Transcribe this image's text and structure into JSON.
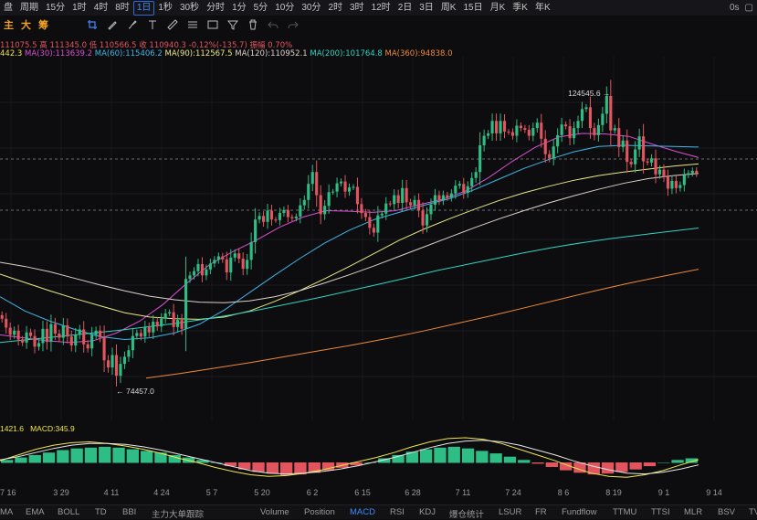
{
  "toolbar": {
    "items": [
      "盘",
      "周期",
      "15分",
      "1时",
      "4时",
      "8时",
      "1日",
      "1秒",
      "30秒",
      "分时",
      "1分",
      "5分",
      "10分",
      "30分",
      "2时",
      "3时",
      "12时",
      "2日",
      "3日",
      "周K",
      "15日",
      "月K",
      "季K",
      "年K"
    ],
    "active_index": 6,
    "right_label": "0s"
  },
  "modes": {
    "m1": "主",
    "m2": "大",
    "m3": "筹"
  },
  "info": {
    "ohlc": [
      {
        "text": "111075.5",
        "color": "#e2555f"
      },
      {
        "text": "高 111345.0",
        "color": "#e2555f"
      },
      {
        "text": "低 110566.5",
        "color": "#e2555f"
      },
      {
        "text": "收 110940.3",
        "color": "#e2555f"
      },
      {
        "text": "-0.12%(-135.7)",
        "color": "#e2555f"
      },
      {
        "text": "振幅 0.70%",
        "color": "#e2555f"
      }
    ],
    "ma": [
      {
        "text": "442.3",
        "color": "#f0e64c"
      },
      {
        "text": "MA(30):113639.2",
        "color": "#d94fd2"
      },
      {
        "text": "MA(60):115406.2",
        "color": "#3eb6e8"
      },
      {
        "text": "MA(90):112567.5",
        "color": "#e8e887"
      },
      {
        "text": "MA(120):110952.1",
        "color": "#dcd2c8"
      },
      {
        "text": "MA(200):101764.8",
        "color": "#2fd4c2"
      },
      {
        "text": "MA(360):94838.0",
        "color": "#ef8a37"
      }
    ]
  },
  "macd_info": {
    "v1": "1421.6",
    "v2": "MACD:345.9",
    "c1": "#f0e64c",
    "c2": "#f0e64c"
  },
  "x_axis": [
    "7 16",
    "3 29",
    "4 11",
    "4 24",
    "5 7",
    "5 20",
    "6 2",
    "6 15",
    "6 28",
    "7 11",
    "7 24",
    "8 6",
    "8 19",
    "9 1",
    "9 14"
  ],
  "bottom_tabs": {
    "items": [
      "MA",
      "EMA",
      "BOLL",
      "TD",
      "BBI",
      "主力大单跟踪",
      "Volume",
      "Position",
      "MACD",
      "RSI",
      "KDJ",
      "爆仓统计",
      "LSUR",
      "FR",
      "Fundflow",
      "TTMU",
      "TTSI",
      "MLR",
      "BSV",
      "TV"
    ],
    "active": "MACD"
  },
  "chart_data": {
    "type": "candlestick",
    "instrument_note": "",
    "max_label": "124545.6",
    "min_label": "74457.0",
    "ylim": [
      70000,
      130000
    ],
    "grid": true,
    "candles_close": [
      86500,
      85000,
      83800,
      84500,
      83000,
      82500,
      84200,
      83600,
      81800,
      82400,
      84800,
      82600,
      85600,
      84000,
      83300,
      85400,
      83500,
      82000,
      83800,
      84700,
      82200,
      81500,
      83800,
      84500,
      83400,
      79500,
      78300,
      80400,
      76900,
      78900,
      80100,
      81200,
      83600,
      84100,
      83500,
      85100,
      84200,
      86000,
      85200,
      86500,
      87400,
      87600,
      85100,
      86300,
      84800,
      93200,
      93800,
      94500,
      95700,
      93800,
      94800,
      95800,
      96400,
      97000,
      96500,
      94300,
      96800,
      97500,
      96600,
      94900,
      96400,
      99400,
      103200,
      103800,
      102800,
      104700,
      103200,
      103100,
      104300,
      104800,
      103600,
      103400,
      103700,
      105600,
      106500,
      109200,
      111200,
      107300,
      104100,
      105500,
      107800,
      107900,
      109300,
      109600,
      107900,
      108600,
      108700,
      105800,
      104300,
      103600,
      101800,
      101000,
      103900,
      104200,
      105900,
      105800,
      107300,
      106000,
      108500,
      106100,
      105600,
      106500,
      104700,
      102200,
      104100,
      105700,
      107300,
      106400,
      107300,
      106900,
      107600,
      108900,
      109200,
      107700,
      108800,
      110200,
      111200,
      115700,
      117300,
      117700,
      119800,
      117700,
      119800,
      118000,
      117900,
      117300,
      119000,
      118600,
      118300,
      117300,
      118600,
      119500,
      116800,
      114200,
      113500,
      115500,
      117400,
      119200,
      118900,
      116900,
      118600,
      119800,
      121800,
      122100,
      118600,
      117400,
      119100,
      121000,
      124000,
      118200,
      118600,
      115400,
      116500,
      112900,
      112500,
      115000,
      117200,
      113000,
      112800,
      113500,
      110800,
      111600,
      110400,
      108400,
      109700,
      108500,
      109000,
      110700,
      111000,
      111400,
      110940
    ],
    "candles_range": [
      [
        87200,
        84800,
        "#e2555f"
      ],
      [
        86400,
        84300,
        "#e2555f"
      ],
      [
        85300,
        83100,
        "#e2555f"
      ],
      [
        85800,
        83300,
        "#2ebd85"
      ]
    ],
    "ma_series": [
      {
        "name": "MA(30)",
        "color": "#d94fd2",
        "values": [
          83800,
          83300,
          82800,
          82500,
          82800,
          84100,
          86100,
          88900,
          92400,
          95600,
          97800,
          99700,
          101900,
          103600,
          104700,
          104600,
          104400,
          104700,
          105700,
          106600,
          108000,
          110300,
          113000,
          115400,
          117100,
          117700,
          117600,
          117200,
          115900,
          114700,
          113639
        ]
      },
      {
        "name": "MA(60)",
        "color": "#3eb6e8",
        "values": [
          90200,
          87800,
          86100,
          84700,
          83500,
          83000,
          83300,
          84100,
          85600,
          88000,
          90900,
          93800,
          96600,
          99200,
          101400,
          103200,
          104400,
          105600,
          106700,
          108200,
          110000,
          111800,
          113300,
          114600,
          115500,
          115700,
          115600,
          115500,
          115406
        ]
      },
      {
        "name": "MA(90)",
        "color": "#e8e887",
        "values": [
          94000,
          92600,
          91200,
          89900,
          88700,
          87500,
          86800,
          86500,
          86400,
          86800,
          87800,
          89400,
          91200,
          93200,
          95300,
          97500,
          99700,
          101600,
          103300,
          104900,
          106400,
          107700,
          108800,
          109800,
          110600,
          111200,
          111700,
          112200,
          112567
        ]
      },
      {
        "name": "MA(120)",
        "color": "#dcd2c8",
        "values": [
          96000,
          95300,
          94400,
          93300,
          92200,
          91200,
          90300,
          89700,
          89300,
          89200,
          89500,
          90200,
          91200,
          92500,
          93900,
          95400,
          97000,
          98600,
          100200,
          101800,
          103300,
          104700,
          106000,
          107200,
          108300,
          109300,
          110100,
          110600,
          110952
        ]
      },
      {
        "name": "MA(200)",
        "color": "#2fd4c2",
        "values": [
          82500,
          83000,
          83500,
          84000,
          84500,
          85100,
          85700,
          86400,
          87200,
          88100,
          89100,
          90100,
          91200,
          92300,
          93400,
          94600,
          95600,
          96600,
          97600,
          98500,
          99300,
          100000,
          100600,
          101200,
          101765
        ]
      },
      {
        "name": "MA(360)",
        "color": "#ef8a37",
        "values": [
          76500,
          77300,
          78200,
          79100,
          80100,
          81100,
          82100,
          83200,
          84400,
          85700,
          87000,
          88400,
          89800,
          91200,
          92500,
          93700,
          94838
        ]
      }
    ],
    "macd": {
      "hist": [
        300,
        600,
        900,
        1200,
        1500,
        1700,
        1800,
        1900,
        1800,
        1600,
        1400,
        1200,
        900,
        600,
        300,
        0,
        -400,
        -800,
        -1100,
        -1300,
        -1500,
        -1400,
        -1200,
        -900,
        -600,
        -300,
        0,
        500,
        900,
        1300,
        1600,
        1800,
        1900,
        1700,
        1400,
        1100,
        700,
        300,
        -100,
        -500,
        -900,
        -1200,
        -1400,
        -1300,
        -1100,
        -800,
        -400,
        0,
        300,
        500
      ],
      "dif": [
        200,
        900,
        1600,
        2100,
        2400,
        2500,
        2300,
        2000,
        1600,
        1100,
        500,
        0,
        -600,
        -1100,
        -1500,
        -1700,
        -1600,
        -1300,
        -900,
        -400,
        100,
        600,
        1200,
        1900,
        2500,
        2900,
        3000,
        2800,
        2300,
        1600,
        900,
        200,
        -600,
        -1300,
        -1700,
        -1800,
        -1500,
        -1000,
        -300,
        346
      ],
      "dea": [
        300,
        700,
        1200,
        1700,
        2100,
        2300,
        2300,
        2200,
        1900,
        1500,
        1000,
        500,
        0,
        -500,
        -1000,
        -1300,
        -1400,
        -1300,
        -1100,
        -800,
        -400,
        100,
        600,
        1200,
        1800,
        2300,
        2600,
        2700,
        2500,
        2100,
        1500,
        900,
        200,
        -400,
        -900,
        -1300,
        -1400,
        -1200,
        -800,
        -300
      ]
    }
  }
}
